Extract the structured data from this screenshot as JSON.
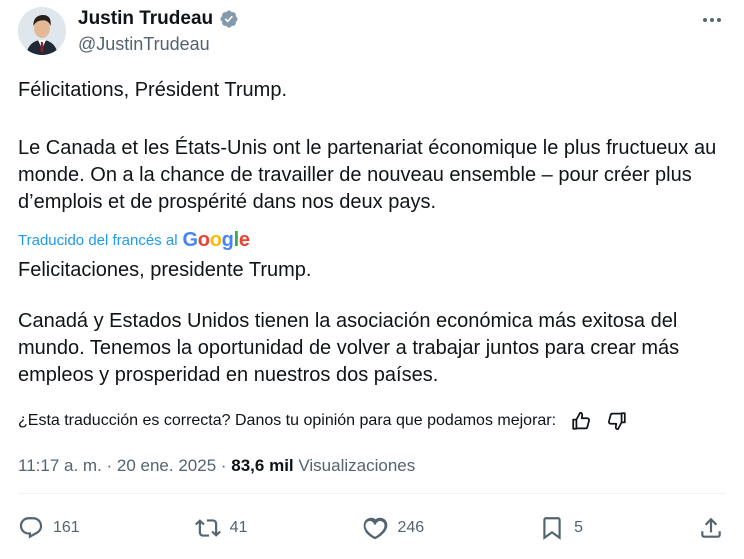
{
  "user": {
    "name": "Justin Trudeau",
    "handle": "@JustinTrudeau",
    "verified": true
  },
  "tweet": {
    "line1": "Félicitations, Président Trump.",
    "line2": "Le Canada et les États-Unis ont le partenariat économique le plus fructueux au monde. On a la chance de travailler de nouveau ensemble – pour créer plus d’emplois et de prospérité dans nos deux pays.",
    "translated_label": "Traducido del francés al",
    "translator": "Google",
    "translation_line1": "Felicitaciones, presidente Trump.",
    "translation_line2": "Canadá y Estados Unidos tienen la asociación económica más exitosa del mundo. Tenemos la oportunidad de volver a trabajar juntos para crear más empleos y prosperidad en nuestros dos países.",
    "feedback_prompt": "¿Esta traducción es correcta? Danos tu opinión para que podamos mejorar:"
  },
  "meta": {
    "time": "11:17 a. m. · 20 ene. 2025 · ",
    "views_count": "83,6 mil",
    "views_label": " Visualizaciones"
  },
  "actions": {
    "replies": "161",
    "reposts": "41",
    "likes": "246",
    "bookmarks": "5"
  },
  "colors": {
    "text": "#0f1419",
    "secondary": "#536471",
    "link": "#1d9bf0",
    "verified": "#829aab"
  },
  "icons": [
    "verified-badge-icon",
    "more-icon",
    "thumbs-up-icon",
    "thumbs-down-icon",
    "reply-icon",
    "repost-icon",
    "like-icon",
    "bookmark-icon",
    "share-icon"
  ]
}
